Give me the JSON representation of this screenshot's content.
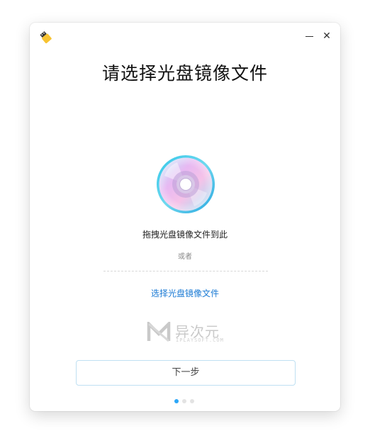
{
  "window": {
    "title": "请选择光盘镜像文件",
    "minimize_icon": "minimize-icon",
    "close_glyph": "✕",
    "app_icon": "usb-drive-icon"
  },
  "main": {
    "disc_icon": "optical-disc-icon",
    "drag_text": "拖拽光盘镜像文件到此",
    "or_text": "或者",
    "select_link": "选择光盘镜像文件"
  },
  "watermark": {
    "title": "异次元",
    "subtitle": "IPLAYSOFT.COM"
  },
  "footer": {
    "next_label": "下一步",
    "steps": [
      {
        "active": true
      },
      {
        "active": false
      },
      {
        "active": false
      }
    ]
  },
  "colors": {
    "accent": "#1a7ad4",
    "active_dot": "#2ca7f8",
    "button_border": "#bfe0f2"
  }
}
